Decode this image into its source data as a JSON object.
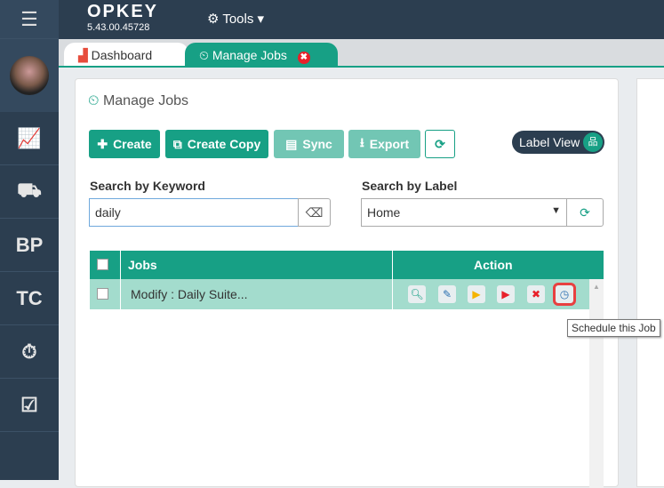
{
  "app": {
    "logo": "OPKEY",
    "version": "5.43.00.45728",
    "tools_menu": "Tools"
  },
  "tabs": [
    {
      "label": "Dashboard"
    },
    {
      "label": "Manage Jobs",
      "close": "✖"
    }
  ],
  "page": {
    "title": "Manage Jobs"
  },
  "toolbar": {
    "create": "Create",
    "create_copy": "Create Copy",
    "sync": "Sync",
    "export": "Export",
    "refresh": "⟳",
    "label_view": "Label View"
  },
  "search": {
    "keyword_label": "Search by Keyword",
    "keyword_value": "daily",
    "label_label": "Search by Label",
    "label_value": "Home"
  },
  "table": {
    "headers": [
      "Jobs",
      "Action"
    ],
    "rows": [
      {
        "job": "Modify : Daily Suite..."
      }
    ]
  },
  "tooltip": "Schedule this Job"
}
